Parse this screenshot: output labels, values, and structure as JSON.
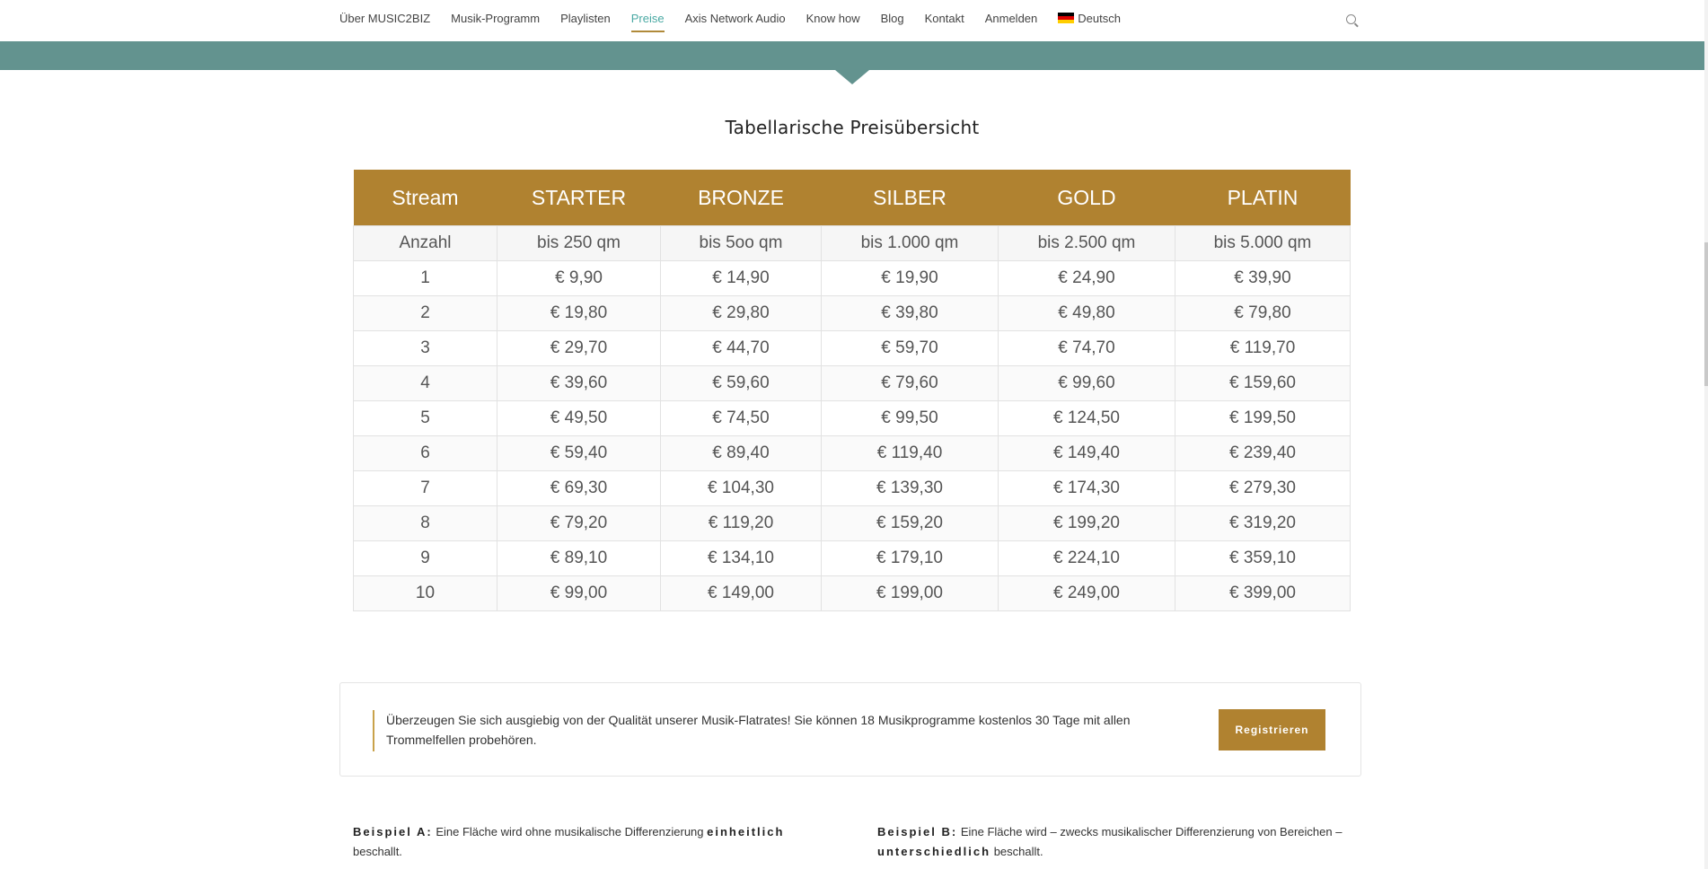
{
  "nav": {
    "items": [
      {
        "label": "Über MUSIC2BIZ",
        "name": "nav-item-ueber"
      },
      {
        "label": "Musik-Programm",
        "name": "nav-item-musik-programm"
      },
      {
        "label": "Playlisten",
        "name": "nav-item-playlisten"
      },
      {
        "label": "Preise",
        "name": "nav-item-preise"
      },
      {
        "label": "Axis Network Audio",
        "name": "nav-item-axis"
      },
      {
        "label": "Know how",
        "name": "nav-item-know-how"
      },
      {
        "label": "Blog",
        "name": "nav-item-blog"
      },
      {
        "label": "Kontakt",
        "name": "nav-item-kontakt"
      },
      {
        "label": "Anmelden",
        "name": "nav-item-anmelden"
      }
    ],
    "active": "Preise",
    "language": "Deutsch",
    "accent_color": "#4aa9a3"
  },
  "section": {
    "title": "Tabellarische Preisübersicht"
  },
  "table": {
    "header_color": "#b08230",
    "headers": [
      "Stream",
      "STARTER",
      "BRONZE",
      "SILBER",
      "GOLD",
      "PLATIN"
    ],
    "subheader": [
      "Anzahl",
      "bis 250 qm",
      "bis 5oo qm",
      "bis 1.000 qm",
      "bis 2.500 qm",
      "bis 5.000 qm"
    ],
    "rows": [
      [
        "1",
        "€ 9,90",
        "€ 14,90",
        "€ 19,90",
        "€ 24,90",
        "€ 39,90"
      ],
      [
        "2",
        "€ 19,80",
        "€ 29,80",
        "€ 39,80",
        "€ 49,80",
        "€ 79,80"
      ],
      [
        "3",
        "€ 29,70",
        "€ 44,70",
        "€ 59,70",
        "€ 74,70",
        "€ 119,70"
      ],
      [
        "4",
        "€ 39,60",
        "€ 59,60",
        "€ 79,60",
        "€ 99,60",
        "€ 159,60"
      ],
      [
        "5",
        "€ 49,50",
        "€ 74,50",
        "€ 99,50",
        "€ 124,50",
        "€ 199,50"
      ],
      [
        "6",
        "€ 59,40",
        "€ 89,40",
        "€ 119,40",
        "€ 149,40",
        "€ 239,40"
      ],
      [
        "7",
        "€ 69,30",
        "€ 104,30",
        "€ 139,30",
        "€ 174,30",
        "€ 279,30"
      ],
      [
        "8",
        "€ 79,20",
        "€ 119,20",
        "€ 159,20",
        "€ 199,20",
        "€ 319,20"
      ],
      [
        "9",
        "€ 89,10",
        "€ 134,10",
        "€ 179,10",
        "€ 224,10",
        "€ 359,10"
      ],
      [
        "10",
        "€ 99,00",
        "€ 149,00",
        "€ 199,00",
        "€ 249,00",
        "€ 399,00"
      ]
    ]
  },
  "callout": {
    "text": "Überzeugen Sie sich ausgiebig von der Qualität unserer Musik-Flatrates! Sie können 18 Musikprogramme kostenlos 30 Tage mit allen Trommelfellen probehören.",
    "button_label": "Registrieren"
  },
  "examples": {
    "a": {
      "label": "Beispiel A:",
      "text_before": "Eine Fläche wird ohne musikalische Differenzierung",
      "emphasis": "einheitlich",
      "text_after": "beschallt."
    },
    "b": {
      "label": "Beispiel B:",
      "text_before": "Eine Fläche wird – zwecks musikalischer Differenzierung von Bereichen –",
      "emphasis": "unterschiedlich",
      "text_after": "beschallt."
    }
  }
}
